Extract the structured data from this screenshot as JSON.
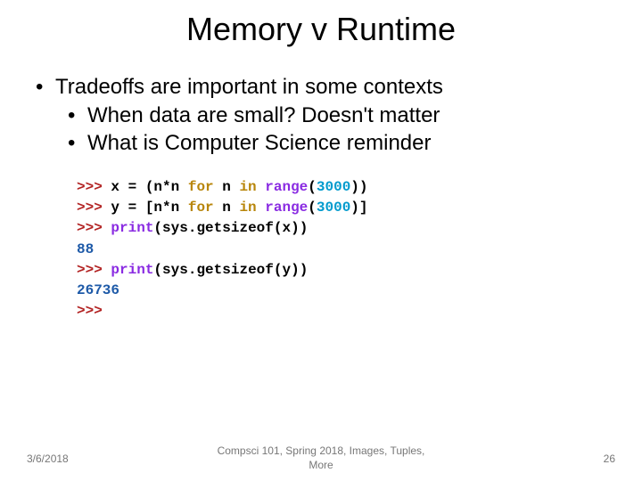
{
  "title": "Memory v Runtime",
  "bullets": {
    "item1": "Tradeoffs are important in some contexts",
    "sub1": "When data are small? Doesn't matter",
    "sub2": "What is Computer Science reminder"
  },
  "code": {
    "prompt": ">>> ",
    "line1": {
      "a": "x ",
      "op": "= (",
      "b": "n",
      "c": "*",
      "d": "n ",
      "kw1": "for ",
      "e": "n ",
      "kw2": "in ",
      "fn": "range",
      "p1": "(",
      "num": "3000",
      "p2": "))"
    },
    "line2": {
      "a": "y ",
      "op": "= [",
      "b": "n",
      "c": "*",
      "d": "n ",
      "kw1": "for ",
      "e": "n ",
      "kw2": "in ",
      "fn": "range",
      "p1": "(",
      "num": "3000",
      "p2": ")]"
    },
    "line3": {
      "fn": "print",
      "p1": "(",
      "a": "sys",
      "dot": ".",
      "m": "getsizeof",
      "p2": "(",
      "b": "x",
      "p3": "))"
    },
    "out1": "88",
    "line4": {
      "fn": "print",
      "p1": "(",
      "a": "sys",
      "dot": ".",
      "m": "getsizeof",
      "p2": "(",
      "b": "y",
      "p3": "))"
    },
    "out2": "26736"
  },
  "footer": {
    "date": "3/6/2018",
    "center": "Compsci 101, Spring 2018, Images, Tuples, More",
    "page": "26"
  }
}
